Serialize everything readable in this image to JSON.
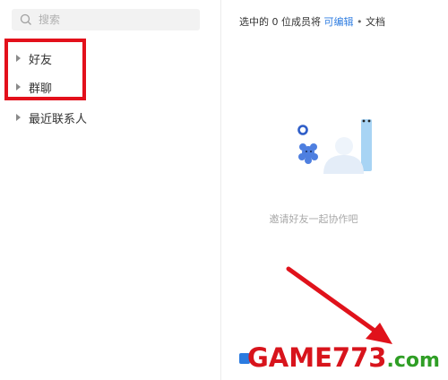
{
  "search": {
    "placeholder": "搜索"
  },
  "groups": [
    {
      "label": "好友"
    },
    {
      "label": "群聊"
    },
    {
      "label": "最近联系人"
    }
  ],
  "header": {
    "prefix": "选中的 0 位成员将",
    "permission": "可编辑",
    "separator": "•",
    "suffix": "文档"
  },
  "empty_state": {
    "text": "邀请好友一起协作吧"
  },
  "watermark": {
    "game": "GAME",
    "number": "773",
    "domain": ".com"
  },
  "colors": {
    "accent": "#2f7de1",
    "highlight": "#e3101b",
    "watermark_red": "#d8141c",
    "watermark_green": "#2f9e25"
  }
}
